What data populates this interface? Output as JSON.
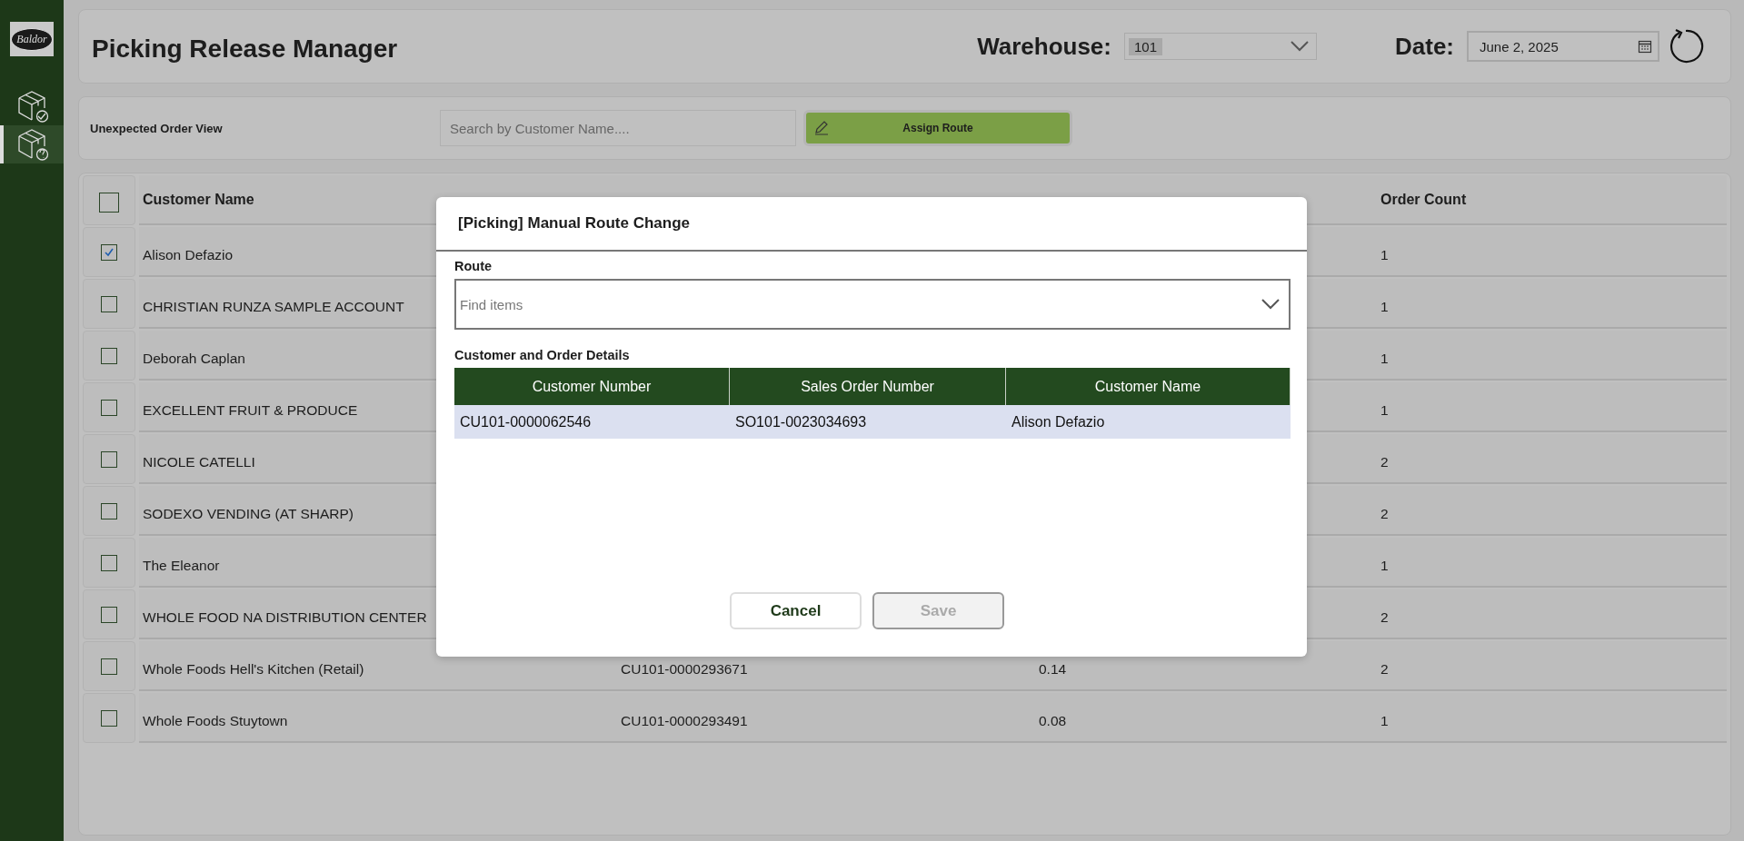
{
  "sidebar": {
    "logo": "Baldor",
    "items": [
      {
        "kind": "check",
        "selected": false
      },
      {
        "kind": "question",
        "selected": true
      }
    ]
  },
  "header": {
    "title": "Picking Release Manager",
    "warehouse_label": "Warehouse:",
    "warehouse_value": "101",
    "date_label": "Date:",
    "date_value": "June 2, 2025"
  },
  "toolbar": {
    "view_label": "Unexpected Order View",
    "search": {
      "placeholder": "Search by Customer Name...."
    },
    "assign_button": "Assign Route"
  },
  "table": {
    "header_checked": false,
    "columns": [
      {
        "label": "Customer Name"
      },
      {
        "label": "Order Count"
      }
    ],
    "rows": [
      {
        "checked": true,
        "customer_name": "Alison Defazio",
        "order_count": "1"
      },
      {
        "checked": false,
        "customer_name": "CHRISTIAN RUNZA SAMPLE ACCOUNT",
        "order_count": "1"
      },
      {
        "checked": false,
        "customer_name": "Deborah Caplan",
        "order_count": "1"
      },
      {
        "checked": false,
        "customer_name": "EXCELLENT FRUIT & PRODUCE",
        "order_count": "1"
      },
      {
        "checked": false,
        "customer_name": "NICOLE CATELLI",
        "order_count": "2"
      },
      {
        "checked": false,
        "customer_name": "SODEXO VENDING (AT SHARP)",
        "order_count": "2"
      },
      {
        "checked": false,
        "customer_name": "The Eleanor",
        "order_count": "1"
      },
      {
        "checked": false,
        "customer_name": "WHOLE FOOD NA DISTRIBUTION CENTER",
        "order_count": "2"
      },
      {
        "checked": false,
        "customer_name": "Whole Foods Hell's Kitchen (Retail)",
        "column_2": "CU101-0000293671",
        "column_3": "0.14",
        "order_count": "2"
      },
      {
        "checked": false,
        "customer_name": "Whole Foods Stuytown",
        "column_2": "CU101-0000293491",
        "column_3": "0.08",
        "order_count": "1"
      }
    ]
  },
  "dialog": {
    "title": "[Picking] Manual Route Change",
    "route_label": "Route",
    "route_field": {
      "placeholder": "Find items"
    },
    "details_label": "Customer and Order Details",
    "columns": [
      "Customer Number",
      "Sales Order Number",
      "Customer Name"
    ],
    "rows": [
      {
        "cells": [
          "CU101-0000062546",
          "SO101-0023034693",
          "Alison Defazio"
        ],
        "selected": true
      }
    ],
    "buttons": [
      {
        "label": "Cancel",
        "disabled": false
      },
      {
        "label": "Save",
        "disabled": true
      }
    ]
  }
}
